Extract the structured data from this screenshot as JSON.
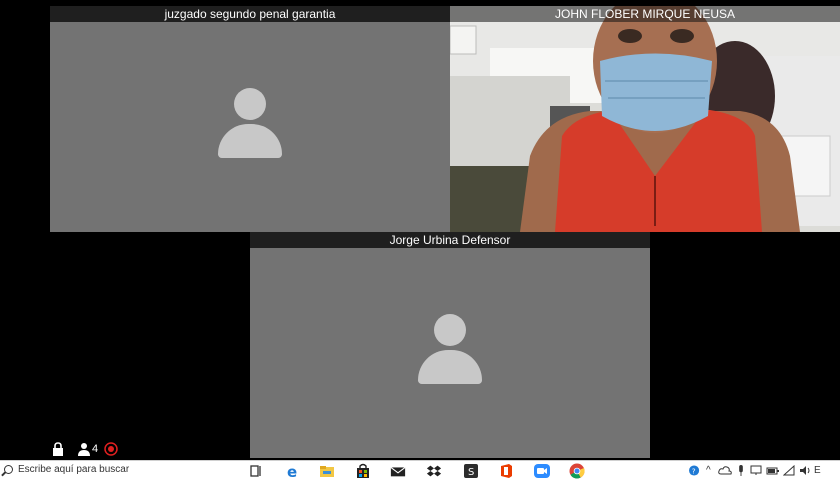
{
  "participants": [
    {
      "name": "juzgado segundo penal garantia",
      "video": false
    },
    {
      "name": "JOHN FLOBER MIRQUE NEUSA",
      "video": true
    },
    {
      "name": "Jorge Urbina Defensor",
      "video": false
    }
  ],
  "meeting_overlay": {
    "participant_count": "4",
    "icons": [
      "lock-icon",
      "participants-icon",
      "record-icon"
    ],
    "record_color": "#e02020"
  },
  "taskbar": {
    "search_placeholder": "Escribe aquí para buscar",
    "apps": [
      "task-view-icon",
      "edge-icon",
      "file-explorer-icon",
      "store-icon",
      "mail-icon",
      "dropbox-icon",
      "sway-icon",
      "office-icon",
      "zoom-icon",
      "chrome-icon"
    ],
    "tray_icons": [
      "help-icon",
      "chevron-up-icon",
      "cloud-icon",
      "microphone-icon",
      "display-icon",
      "battery-icon",
      "wifi-icon",
      "volume-icon"
    ],
    "tray_text": "E"
  }
}
